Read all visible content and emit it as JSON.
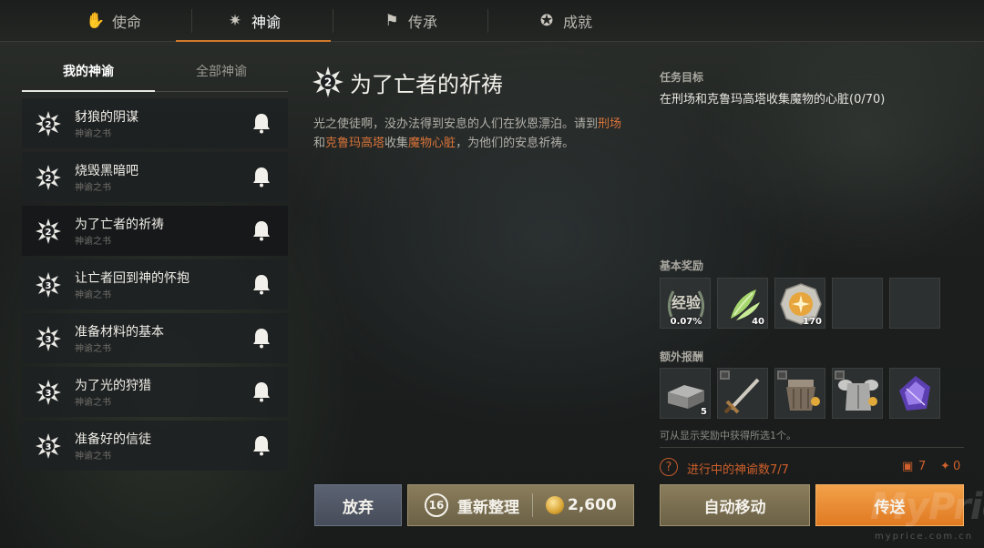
{
  "top_tabs": [
    {
      "label": "使命",
      "icon": "hand-flame-icon"
    },
    {
      "label": "神谕",
      "icon": "star-burst-icon"
    },
    {
      "label": "传承",
      "icon": "flag-icon"
    },
    {
      "label": "成就",
      "icon": "medal-icon"
    }
  ],
  "active_top_tab": "神谕",
  "sub_tabs": [
    "我的神谕",
    "全部神谕"
  ],
  "quests": [
    {
      "title": "豺狼的阴谋",
      "subtitle": "神谕之书",
      "level": "2"
    },
    {
      "title": "烧毁黑暗吧",
      "subtitle": "神谕之书",
      "level": "2"
    },
    {
      "title": "为了亡者的祈祷",
      "subtitle": "神谕之书",
      "level": "2"
    },
    {
      "title": "让亡者回到神的怀抱",
      "subtitle": "神谕之书",
      "level": "3"
    },
    {
      "title": "准备材料的基本",
      "subtitle": "神谕之书",
      "level": "3"
    },
    {
      "title": "为了光的狩猎",
      "subtitle": "神谕之书",
      "level": "3"
    },
    {
      "title": "准备好的信徒",
      "subtitle": "神谕之书",
      "level": "3"
    }
  ],
  "detail": {
    "level": "2",
    "title": "为了亡者的祈祷",
    "desc_1": "光之使徒啊，没办法得到安息的人们在狄恩漂泊。请到",
    "desc_hl_1": "刑场",
    "desc_2": "和",
    "desc_hl_2": "克鲁玛高塔",
    "desc_3": "收集",
    "desc_hl_3": "魔物心脏",
    "desc_4": "，为他们的安息祈祷。"
  },
  "objective": {
    "label": "任务目标",
    "text": "在刑场和克鲁玛高塔收集魔物的心脏(0/70)"
  },
  "basic_rewards": {
    "label": "基本奖励",
    "items": [
      {
        "icon": "exp-laurel-icon",
        "name": "经验",
        "value": "0.07%"
      },
      {
        "icon": "green-feather-icon",
        "value": "40"
      },
      {
        "icon": "gold-medal-icon",
        "value": "170"
      },
      {
        "icon": "empty-slot",
        "value": ""
      },
      {
        "icon": "empty-slot",
        "value": ""
      }
    ]
  },
  "extra_rewards": {
    "label": "额外报酬",
    "items": [
      {
        "icon": "iron-ingot-icon",
        "value": "5",
        "book": false
      },
      {
        "icon": "sword-icon",
        "value": "",
        "book": true
      },
      {
        "icon": "leather-armor-icon",
        "value": "",
        "book": true
      },
      {
        "icon": "plate-armor-icon",
        "value": "",
        "book": true
      },
      {
        "icon": "purple-crystal-icon",
        "value": "",
        "book": false
      }
    ],
    "note": "可从显示奖励中获得所选1个。"
  },
  "progress": {
    "help": "?",
    "text": "进行中的神谕数7/7",
    "count_a": "7",
    "count_b": "0"
  },
  "buttons": {
    "give_up": "放弃",
    "reset_count": "16",
    "reset": "重新整理",
    "reset_cost": "2,600",
    "auto_move": "自动移动",
    "teleport": "传送"
  },
  "watermark": {
    "logo": "MyPrice",
    "url": "myprice.com.cn"
  }
}
